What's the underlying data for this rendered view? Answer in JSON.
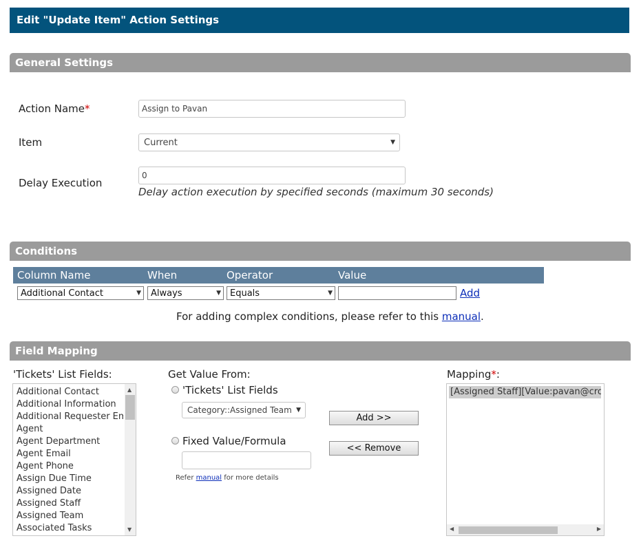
{
  "window": {
    "title": "Edit \"Update Item\" Action Settings"
  },
  "general": {
    "header": "General Settings",
    "action_name_label": "Action Name",
    "required_mark": "*",
    "action_name_value": "Assign to Pavan",
    "item_label": "Item",
    "item_value": "Current",
    "delay_label": "Delay Execution",
    "delay_value": "0",
    "delay_hint": "Delay action execution by specified seconds (maximum 30 seconds)"
  },
  "conditions": {
    "header": "Conditions",
    "columns": [
      "Column Name",
      "When",
      "Operator",
      "Value"
    ],
    "column_name_value": "Additional Contact",
    "when_value": "Always",
    "operator_value": "Equals",
    "value_input": "",
    "add_link": "Add",
    "note_prefix": "For adding complex conditions, please refer to this ",
    "note_link": "manual",
    "note_suffix": "."
  },
  "mapping": {
    "header": "Field Mapping",
    "list_fields_label": "'Tickets' List Fields:",
    "list_fields": [
      "Additional Contact",
      "Additional Information",
      "Additional Requester Email",
      "Agent",
      "Agent Department",
      "Agent Email",
      "Agent Phone",
      "Assign Due Time",
      "Assigned Date",
      "Assigned Staff",
      "Assigned Team",
      "Associated Tasks"
    ],
    "get_value_label": "Get Value From:",
    "option_list_label": "'Tickets' List Fields",
    "option_list_select": "Category::Assigned Team",
    "option_fixed_label": "Fixed Value/Formula",
    "fixed_value": "",
    "refer_prefix": "Refer ",
    "refer_link": "manual",
    "refer_suffix": " for more details",
    "add_button": "Add >>",
    "remove_button": "<< Remove",
    "mapping_label": "Mapping",
    "mapping_suffix": ":",
    "mapping_items": [
      "[Assigned Staff][Value:pavan@crowcanyon.com]"
    ]
  },
  "colors": {
    "titlebar": "#03537c",
    "section_header": "#9b9b9b",
    "condition_header": "#5e7f9c",
    "required": "#d00000",
    "link": "#0b2db8"
  }
}
